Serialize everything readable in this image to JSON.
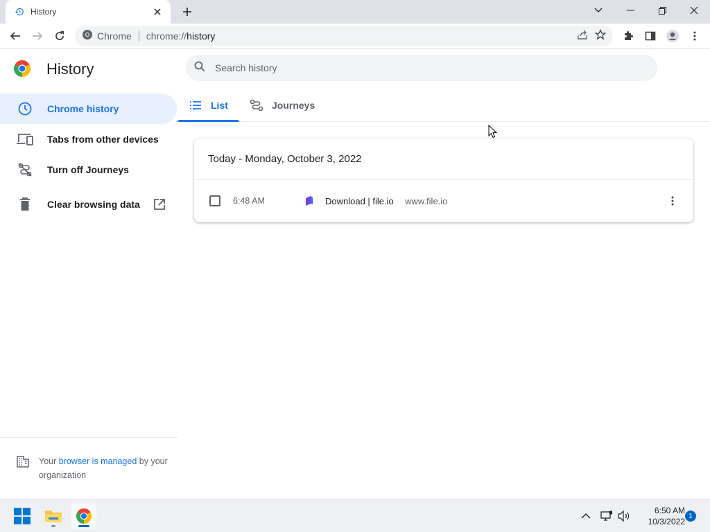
{
  "browser": {
    "tab_title": "History",
    "site_chip": "Chrome",
    "url_scheme": "chrome://",
    "url_host": "history"
  },
  "page": {
    "title": "History",
    "search_placeholder": "Search history",
    "sidebar": [
      {
        "label": "Chrome history",
        "icon": "clock-icon",
        "active": true
      },
      {
        "label": "Tabs from other devices",
        "icon": "devices-icon",
        "active": false
      },
      {
        "label": "Turn off Journeys",
        "icon": "journeys-off-icon",
        "active": false
      },
      {
        "label": "Clear browsing data",
        "icon": "trash-icon",
        "active": false
      }
    ],
    "managed": {
      "prefix": "Your ",
      "link": "browser is managed",
      "suffix": " by your organization"
    },
    "tabs": [
      {
        "label": "List",
        "active": true
      },
      {
        "label": "Journeys",
        "active": false
      }
    ],
    "day_header": "Today - Monday, October 3, 2022",
    "entries": [
      {
        "time": "6:48 AM",
        "title": "Download | file.io",
        "domain": "www.file.io"
      }
    ]
  },
  "taskbar": {
    "time": "6:50 AM",
    "date": "10/3/2022",
    "notification_count": "1"
  },
  "colors": {
    "accent": "#1a73e8",
    "active_bg": "#e8f0fe",
    "tabstrip": "#dee1e6"
  }
}
